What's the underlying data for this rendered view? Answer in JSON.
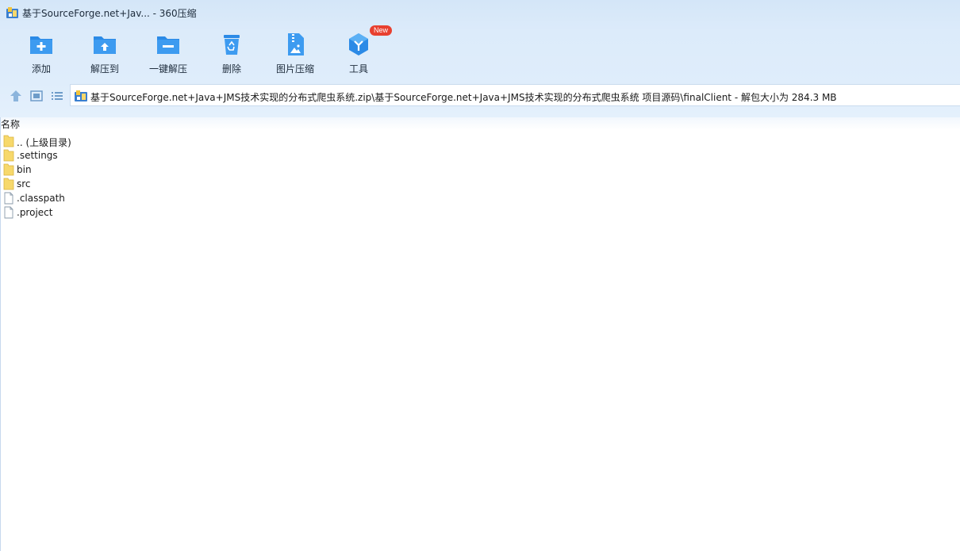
{
  "window": {
    "title": "基于SourceForge.net+Jav... - 360压缩"
  },
  "toolbar": {
    "items": [
      {
        "label": "添加",
        "icon": "add-folder-icon"
      },
      {
        "label": "解压到",
        "icon": "extract-to-icon"
      },
      {
        "label": "一键解压",
        "icon": "one-click-extract-icon"
      },
      {
        "label": "删除",
        "icon": "recycle-bin-icon"
      },
      {
        "label": "图片压缩",
        "icon": "image-compress-icon"
      },
      {
        "label": "工具",
        "icon": "tools-cube-icon"
      }
    ],
    "badge": "New"
  },
  "address": {
    "path": "基于SourceForge.net+Java+JMS技术实现的分布式爬虫系统.zip\\基于SourceForge.net+Java+JMS技术实现的分布式爬虫系统 项目源码\\finalClient - 解包大小为 284.3 MB"
  },
  "list": {
    "column_name": "名称",
    "rows": [
      {
        "name": ".. (上级目录)",
        "type": "folder"
      },
      {
        "name": ".settings",
        "type": "folder"
      },
      {
        "name": "bin",
        "type": "folder"
      },
      {
        "name": "src",
        "type": "folder"
      },
      {
        "name": ".classpath",
        "type": "file"
      },
      {
        "name": ".project",
        "type": "file"
      }
    ]
  },
  "colors": {
    "accent": "#2b8ae6",
    "badge": "#e8402f",
    "folder": "#f7d86b"
  }
}
